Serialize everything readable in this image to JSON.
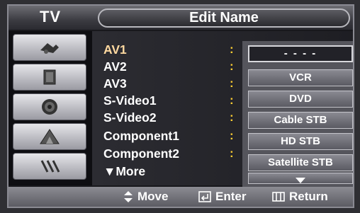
{
  "header": {
    "tv_label": "TV",
    "title": "Edit Name"
  },
  "sidebar": {
    "items": [
      {
        "icon": "picture-icon"
      },
      {
        "icon": "sound-icon"
      },
      {
        "icon": "channel-icon"
      },
      {
        "icon": "setup-icon"
      },
      {
        "icon": "input-icon"
      }
    ]
  },
  "menu": {
    "rows": [
      {
        "label": "AV1"
      },
      {
        "label": "AV2"
      },
      {
        "label": "AV3"
      },
      {
        "label": "S-Video1"
      },
      {
        "label": "S-Video2"
      },
      {
        "label": "Component1"
      },
      {
        "label": "Component2"
      },
      {
        "label": "▼More"
      }
    ],
    "colon": ":"
  },
  "dropdown": {
    "options": [
      "- - - -",
      "VCR",
      "DVD",
      "Cable STB",
      "HD STB",
      "Satellite STB"
    ],
    "more_icon": "down-arrow-icon"
  },
  "footer": {
    "move": "Move",
    "enter": "Enter",
    "return": "Return"
  }
}
